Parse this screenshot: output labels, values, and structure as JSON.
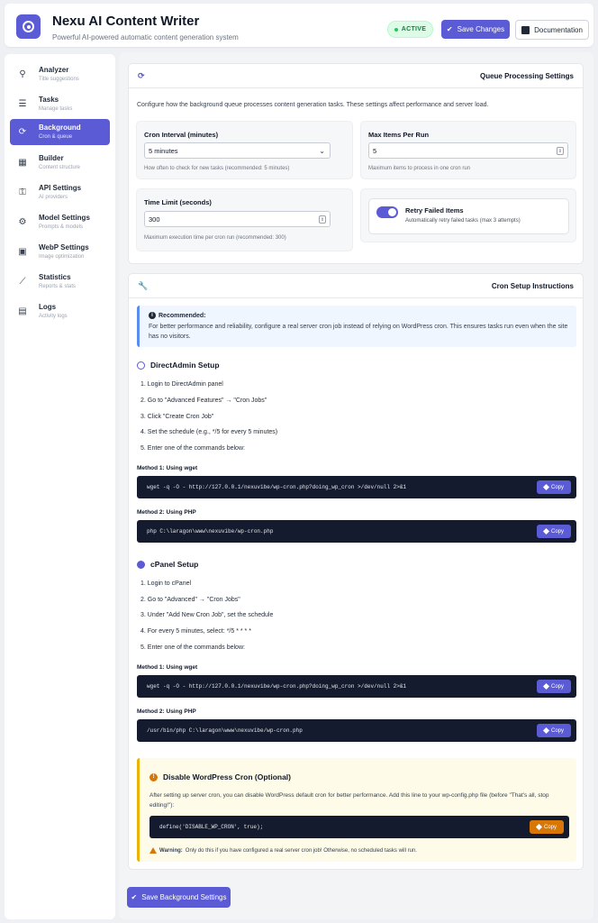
{
  "header": {
    "title": "Nexu AI Content Writer",
    "subtitle": "Powerful AI-powered automatic content generation system",
    "status": "ACTIVE",
    "save_label": "Save Changes",
    "docs_label": "Documentation"
  },
  "sidebar": {
    "items": [
      {
        "label": "Analyzer",
        "sub": "Title suggestions",
        "icon": "search-icon"
      },
      {
        "label": "Tasks",
        "sub": "Manage tasks",
        "icon": "list-icon"
      },
      {
        "label": "Background",
        "sub": "Cron & queue",
        "icon": "sync-icon",
        "active": true
      },
      {
        "label": "Builder",
        "sub": "Content structure",
        "icon": "grid-icon"
      },
      {
        "label": "API Settings",
        "sub": "AI providers",
        "icon": "key-icon"
      },
      {
        "label": "Model Settings",
        "sub": "Prompts & models",
        "icon": "gear-icon"
      },
      {
        "label": "WebP Settings",
        "sub": "Image optimization",
        "icon": "image-icon"
      },
      {
        "label": "Statistics",
        "sub": "Reports & stats",
        "icon": "chart-icon"
      },
      {
        "label": "Logs",
        "sub": "Activity logs",
        "icon": "file-icon"
      }
    ]
  },
  "queue": {
    "title": "Queue Processing Settings",
    "description": "Configure how the background queue processes content generation tasks. These settings affect performance and server load.",
    "cron_interval": {
      "label": "Cron Interval (minutes)",
      "value": "5 minutes",
      "help": "How often to check for new tasks (recommended: 5 minutes)"
    },
    "max_items": {
      "label": "Max Items Per Run",
      "value": "5",
      "help": "Maximum items to process in one cron run"
    },
    "time_limit": {
      "label": "Time Limit (seconds)",
      "value": "300",
      "help": "Maximum execution time per cron run (recommended: 300)"
    },
    "retry": {
      "label": "Retry Failed Items",
      "desc": "Automatically retry failed tasks (max 3 attempts)",
      "enabled": true
    }
  },
  "cron": {
    "title": "Cron Setup Instructions",
    "recommended_title": "Recommended:",
    "recommended_text": "For better performance and reliability, configure a real server cron job instead of relying on WordPress cron. This ensures tasks run even when the site has no visitors.",
    "directadmin": {
      "title": "DirectAdmin Setup",
      "steps": [
        "1. Login to DirectAdmin panel",
        "2. Go to \"Advanced Features\" → \"Cron Jobs\"",
        "3. Click \"Create Cron Job\"",
        "4. Set the schedule (e.g., */5 for every 5 minutes)",
        "5. Enter one of the commands below:"
      ],
      "method1_label": "Method 1: Using wget",
      "method1_code": "wget -q -O - http://127.0.0.1/nexuvibe/wp-cron.php?doing_wp_cron >/dev/null 2>&1",
      "method2_label": "Method 2: Using PHP",
      "method2_code": "php C:\\laragon\\www\\nexuvibe/wp-cron.php"
    },
    "cpanel": {
      "title": "cPanel Setup",
      "steps": [
        "1. Login to cPanel",
        "2. Go to \"Advanced\" → \"Cron Jobs\"",
        "3. Under \"Add New Cron Job\", set the schedule",
        "4. For every 5 minutes, select: */5 * * * *",
        "5. Enter one of the commands below:"
      ],
      "method1_label": "Method 1: Using wget",
      "method1_code": "wget -q -O - http://127.0.0.1/nexuvibe/wp-cron.php?doing_wp_cron >/dev/null 2>&1",
      "method2_label": "Method 2: Using PHP",
      "method2_code": "/usr/bin/php C:\\laragon\\www\\nexuvibe/wp-cron.php"
    },
    "copy_label": "Copy",
    "disable": {
      "title": "Disable WordPress Cron (Optional)",
      "desc": "After setting up server cron, you can disable WordPress default cron for better performance. Add this line to your wp-config.php file (before \"That's all, stop editing!\"):",
      "code": "define('DISABLE_WP_CRON', true);",
      "warning_bold": "Warning:",
      "warning_text": "Only do this if you have configured a real server cron job! Otherwise, no scheduled tasks will run."
    }
  },
  "save_background_label": "Save Background Settings",
  "colors": {
    "accent": "#5b5bd6",
    "success": "#22c55e",
    "warning": "#d97706",
    "code_bg": "#151b2e"
  }
}
